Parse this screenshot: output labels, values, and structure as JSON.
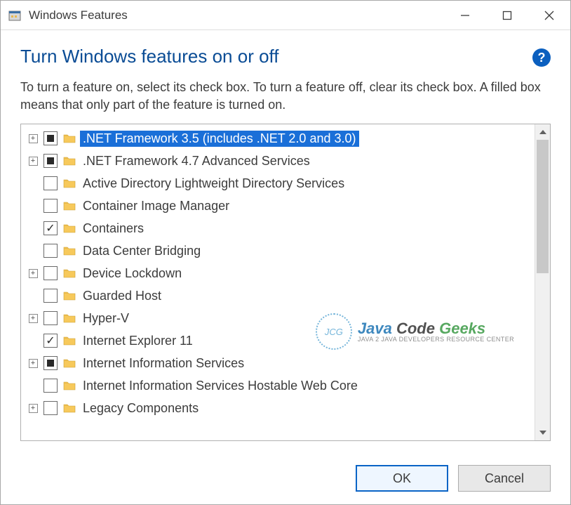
{
  "window": {
    "title": "Windows Features"
  },
  "heading": "Turn Windows features on or off",
  "description": "To turn a feature on, select its check box. To turn a feature off, clear its check box. A filled box means that only part of the feature is turned on.",
  "features": [
    {
      "label": ".NET Framework 3.5 (includes .NET 2.0 and 3.0)",
      "expandable": true,
      "state": "partial",
      "selected": true
    },
    {
      "label": ".NET Framework 4.7 Advanced Services",
      "expandable": true,
      "state": "partial",
      "selected": false
    },
    {
      "label": "Active Directory Lightweight Directory Services",
      "expandable": false,
      "state": "unchecked",
      "selected": false
    },
    {
      "label": "Container Image Manager",
      "expandable": false,
      "state": "unchecked",
      "selected": false
    },
    {
      "label": "Containers",
      "expandable": false,
      "state": "checked",
      "selected": false
    },
    {
      "label": "Data Center Bridging",
      "expandable": false,
      "state": "unchecked",
      "selected": false
    },
    {
      "label": "Device Lockdown",
      "expandable": true,
      "state": "unchecked",
      "selected": false
    },
    {
      "label": "Guarded Host",
      "expandable": false,
      "state": "unchecked",
      "selected": false
    },
    {
      "label": "Hyper-V",
      "expandable": true,
      "state": "unchecked",
      "selected": false
    },
    {
      "label": "Internet Explorer 11",
      "expandable": false,
      "state": "checked",
      "selected": false
    },
    {
      "label": "Internet Information Services",
      "expandable": true,
      "state": "partial",
      "selected": false
    },
    {
      "label": "Internet Information Services Hostable Web Core",
      "expandable": false,
      "state": "unchecked",
      "selected": false
    },
    {
      "label": "Legacy Components",
      "expandable": true,
      "state": "unchecked",
      "selected": false
    }
  ],
  "buttons": {
    "ok": "OK",
    "cancel": "Cancel"
  },
  "watermark": {
    "badge": "JCG",
    "main_java": "Java ",
    "main_code": "Code ",
    "main_geeks": "Geeks",
    "sub": "JAVA 2 JAVA DEVELOPERS RESOURCE CENTER"
  }
}
